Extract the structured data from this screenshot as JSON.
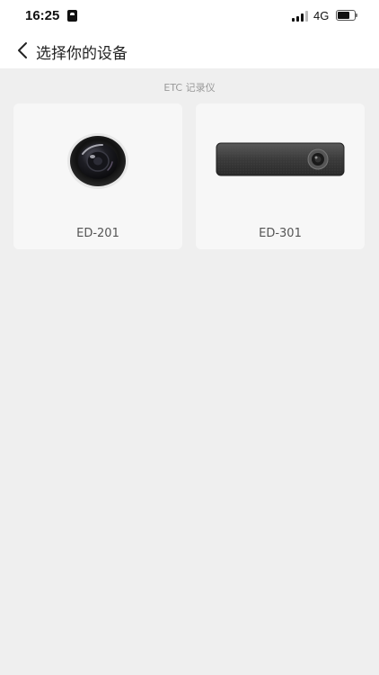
{
  "status_bar": {
    "time": "16:25",
    "network": "4G",
    "battery_level": 0.7
  },
  "header": {
    "title": "选择你的设备"
  },
  "section": {
    "label": "ETC 记录仪"
  },
  "devices": [
    {
      "name": "ED-201",
      "image": "round-camera-lens"
    },
    {
      "name": "ED-301",
      "image": "bar-dashcam"
    }
  ]
}
